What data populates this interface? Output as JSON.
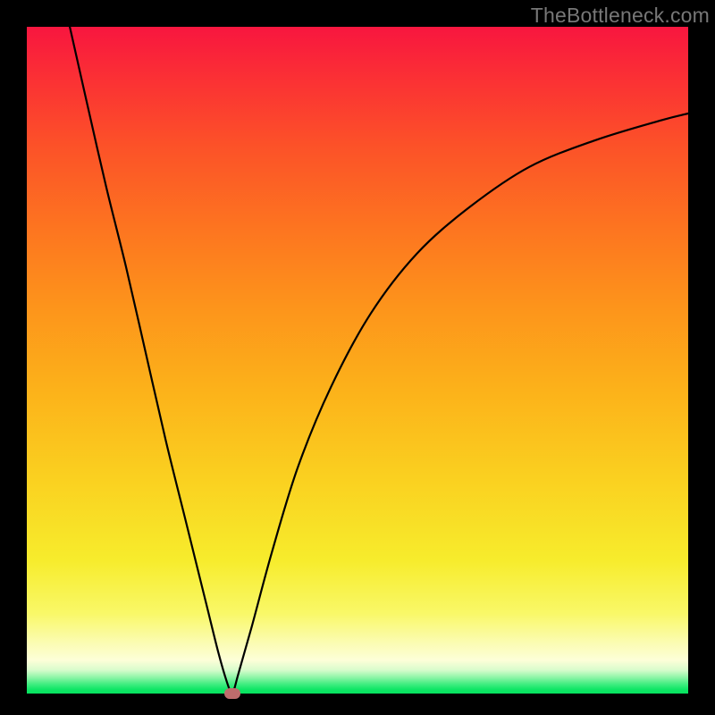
{
  "watermark": "TheBottleneck.com",
  "colors": {
    "frame": "#000000",
    "curve": "#000000",
    "marker": "#be6c6c",
    "gradient_stops": [
      {
        "pos": 0.0,
        "hex": "#f8163f"
      },
      {
        "pos": 0.08,
        "hex": "#fb3134"
      },
      {
        "pos": 0.18,
        "hex": "#fc5228"
      },
      {
        "pos": 0.3,
        "hex": "#fd7420"
      },
      {
        "pos": 0.42,
        "hex": "#fd941b"
      },
      {
        "pos": 0.55,
        "hex": "#fcb31a"
      },
      {
        "pos": 0.68,
        "hex": "#fad120"
      },
      {
        "pos": 0.8,
        "hex": "#f7ec2c"
      },
      {
        "pos": 0.88,
        "hex": "#f9f868"
      },
      {
        "pos": 0.925,
        "hex": "#fbfcb4"
      },
      {
        "pos": 0.95,
        "hex": "#fdfed8"
      },
      {
        "pos": 0.965,
        "hex": "#d7fccc"
      },
      {
        "pos": 0.976,
        "hex": "#8cf5a6"
      },
      {
        "pos": 0.986,
        "hex": "#3fed80"
      },
      {
        "pos": 0.994,
        "hex": "#0fe665"
      },
      {
        "pos": 1.0,
        "hex": "#06e35f"
      }
    ]
  },
  "chart_data": {
    "type": "line",
    "title": "",
    "xlabel": "",
    "ylabel": "",
    "xlim": [
      0,
      1
    ],
    "ylim": [
      0,
      1
    ],
    "note": "Axes are unlabeled. Values are normalized pixel-space estimates (0 = left/bottom, 1 = right/top of plot area).",
    "series": [
      {
        "name": "bottleneck-curve",
        "x": [
          0.065,
          0.09,
          0.12,
          0.15,
          0.18,
          0.21,
          0.24,
          0.27,
          0.29,
          0.305,
          0.311,
          0.32,
          0.34,
          0.37,
          0.41,
          0.46,
          0.52,
          0.59,
          0.67,
          0.76,
          0.86,
          0.96,
          1.0
        ],
        "y": [
          1.0,
          0.89,
          0.76,
          0.64,
          0.51,
          0.38,
          0.26,
          0.14,
          0.06,
          0.01,
          0.0,
          0.03,
          0.1,
          0.21,
          0.34,
          0.46,
          0.57,
          0.66,
          0.73,
          0.79,
          0.83,
          0.86,
          0.87
        ]
      }
    ],
    "marker": {
      "x": 0.311,
      "y": 0.0
    }
  }
}
